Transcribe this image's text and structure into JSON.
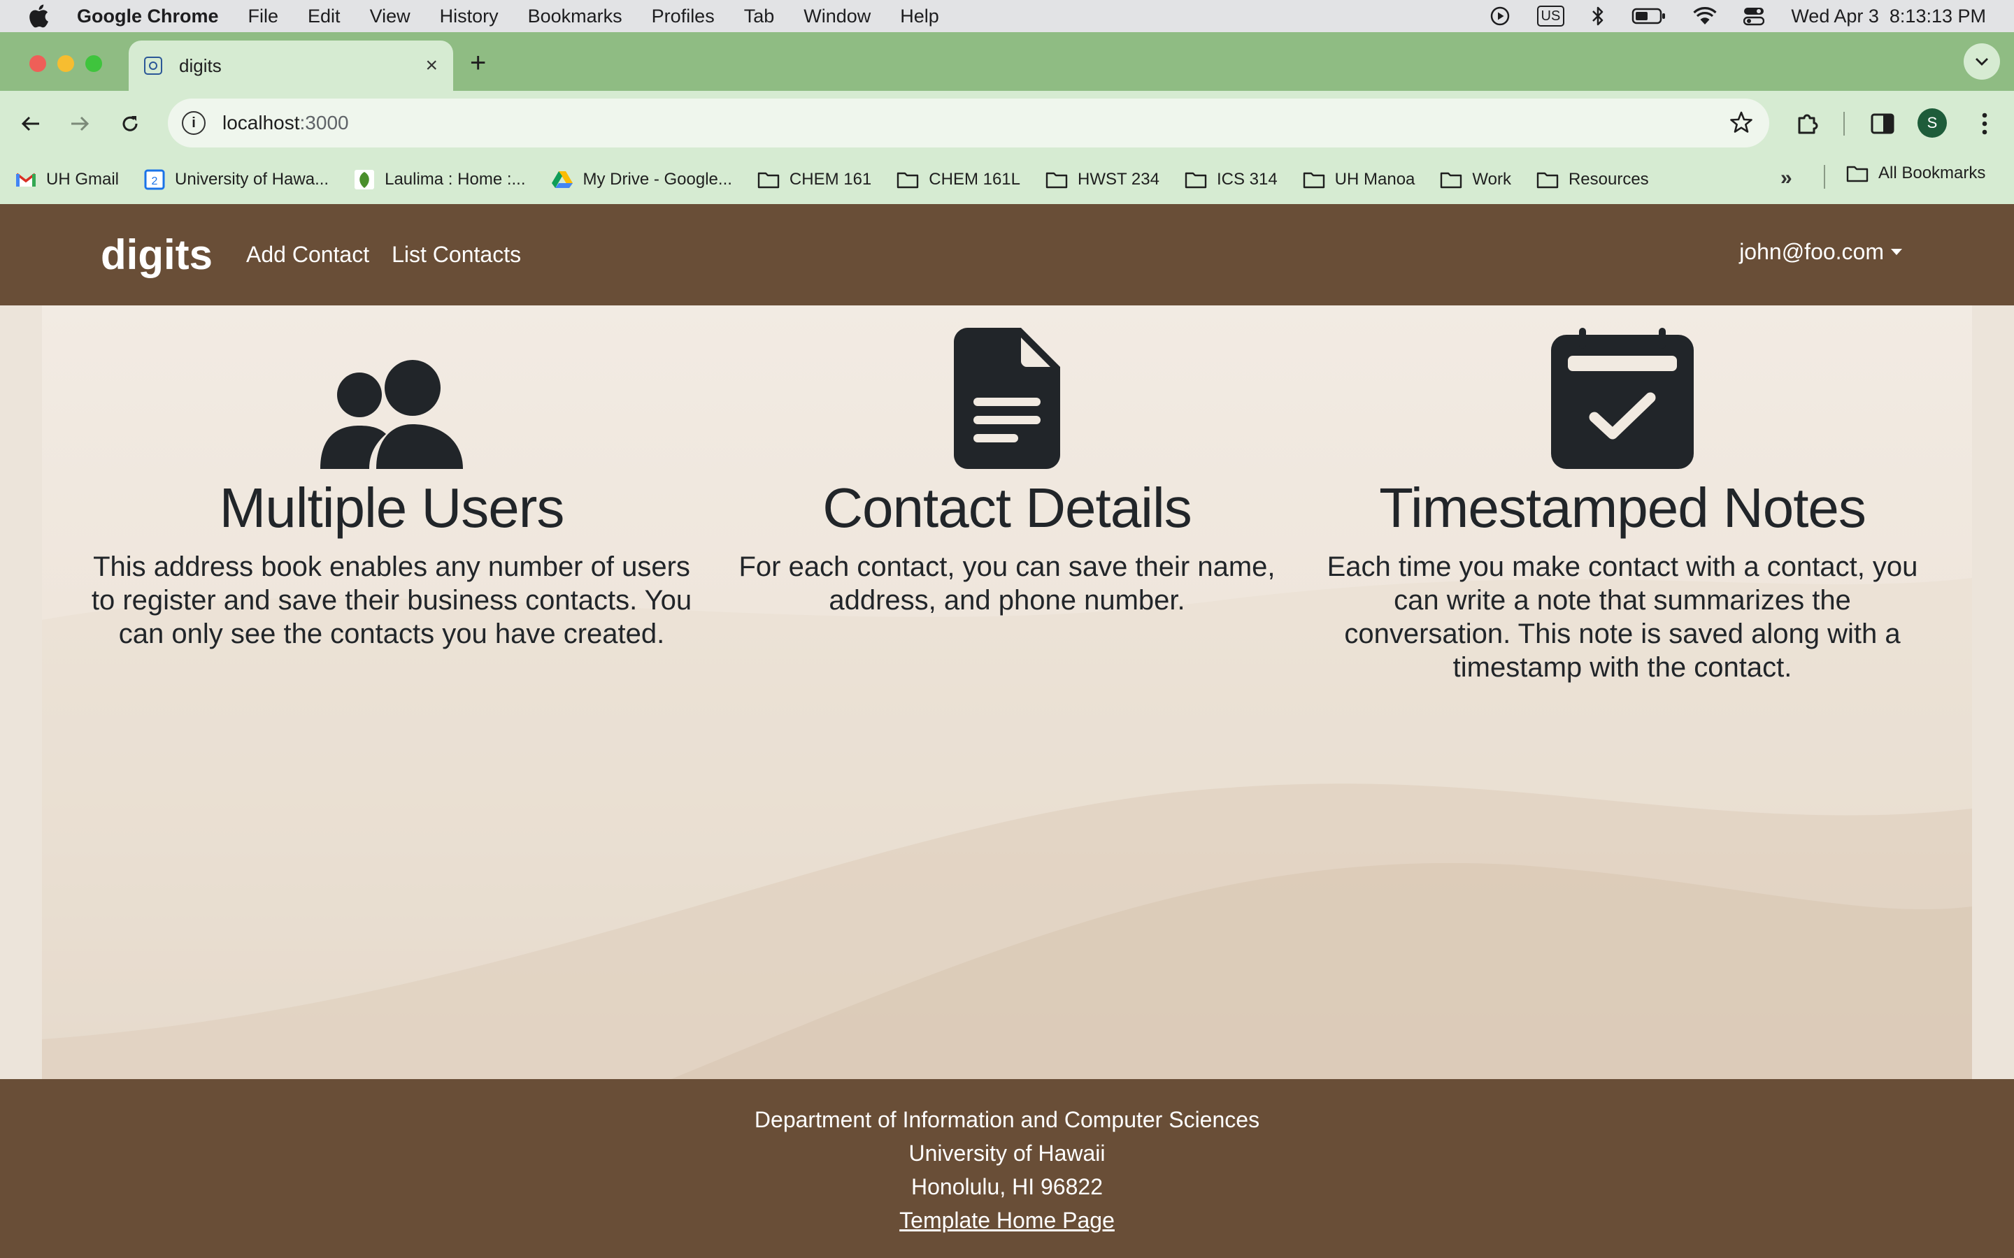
{
  "menubar": {
    "app": "Google Chrome",
    "items": [
      "File",
      "Edit",
      "View",
      "History",
      "Bookmarks",
      "Profiles",
      "Tab",
      "Window",
      "Help"
    ],
    "keyboard": "US",
    "date": "Wed Apr 3",
    "time": "8:13:13 PM"
  },
  "tab": {
    "title": "digits",
    "close": "×"
  },
  "newtab": "+",
  "address": {
    "host": "localhost",
    "port": ":3000"
  },
  "profile_initial": "S",
  "bookmarks": {
    "items": [
      {
        "label": "UH Gmail",
        "icon": "gmail-icon"
      },
      {
        "label": "University of Hawa...",
        "icon": "calendar-icon"
      },
      {
        "label": "Laulima : Home :...",
        "icon": "laulima-icon"
      },
      {
        "label": "My Drive - Google...",
        "icon": "google-drive-icon"
      },
      {
        "label": "CHEM 161",
        "icon": "folder-icon"
      },
      {
        "label": "CHEM 161L",
        "icon": "folder-icon"
      },
      {
        "label": "HWST 234",
        "icon": "folder-icon"
      },
      {
        "label": "ICS 314",
        "icon": "folder-icon"
      },
      {
        "label": "UH Manoa",
        "icon": "folder-icon"
      },
      {
        "label": "Work",
        "icon": "folder-icon"
      },
      {
        "label": "Resources",
        "icon": "folder-icon"
      }
    ],
    "more": "»",
    "all": "All Bookmarks"
  },
  "navbar": {
    "brand": "digits",
    "links": [
      "Add Contact",
      "List Contacts"
    ],
    "user": "john@foo.com"
  },
  "features": [
    {
      "icon": "people-icon",
      "title": "Multiple Users",
      "text": "This address book enables any number of users to register and save their business contacts. You can only see the contacts you have created."
    },
    {
      "icon": "document-icon",
      "title": "Contact Details",
      "text": "For each contact, you can save their name, address, and phone number."
    },
    {
      "icon": "calendar-check-icon",
      "title": "Timestamped Notes",
      "text": "Each time you make contact with a contact, you can write a note that summarizes the conversation. This note is saved along with a timestamp with the contact."
    }
  ],
  "footer": {
    "lines": [
      "Department of Information and Computer Sciences",
      "University of Hawaii",
      "Honolulu, HI 96822"
    ],
    "link": "Template Home Page"
  },
  "colors": {
    "navbar": "#694e37",
    "tabstrip": "#8fbc83",
    "toolbar": "#d6ebd2",
    "icon": "#212529"
  }
}
